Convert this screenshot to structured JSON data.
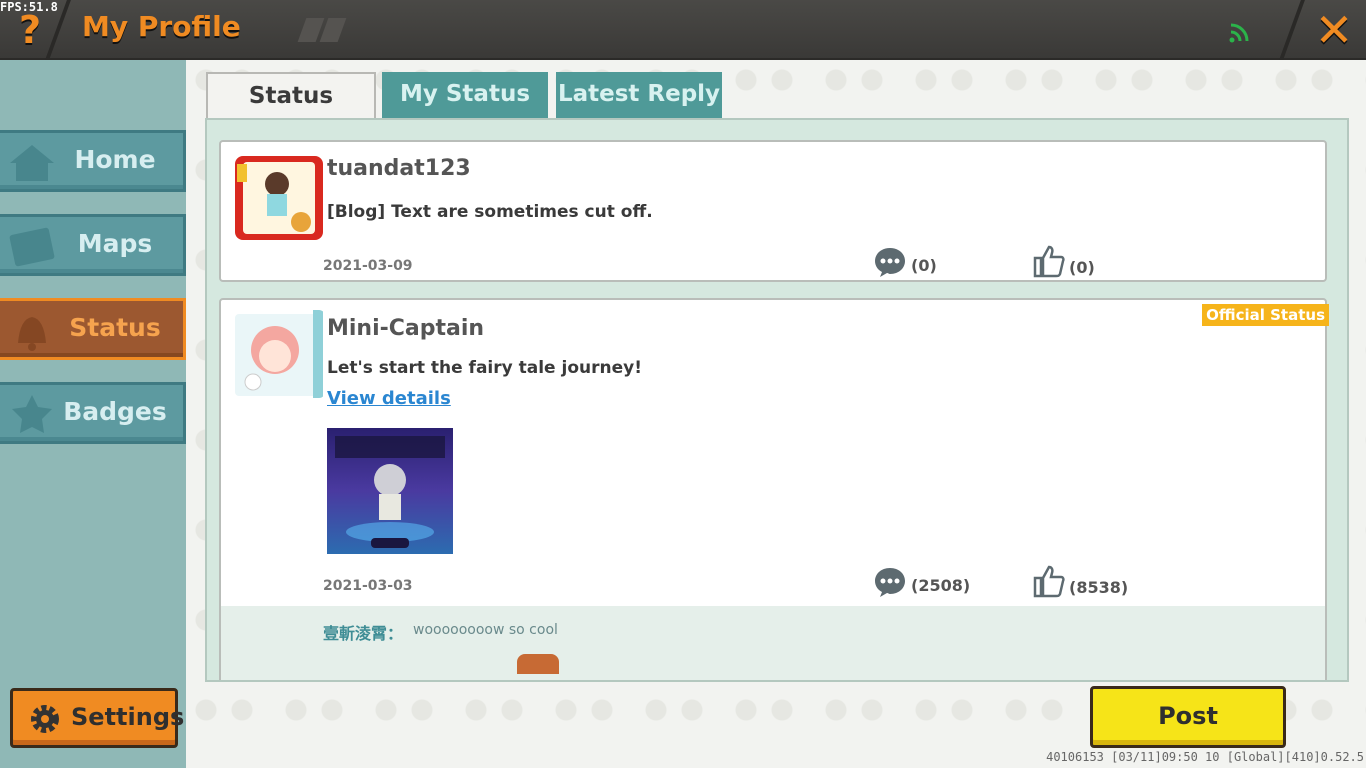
{
  "header": {
    "fps": "FPS:51.8",
    "help_symbol": "?",
    "title": "My Profile",
    "close_symbol": "✕"
  },
  "sidebar": {
    "items": [
      {
        "label": "Home",
        "icon": "home-icon",
        "active": false
      },
      {
        "label": "Maps",
        "icon": "map-icon",
        "active": false
      },
      {
        "label": "Status",
        "icon": "bell-icon",
        "active": true
      },
      {
        "label": "Badges",
        "icon": "badge-icon",
        "active": false
      }
    ],
    "settings_label": "Settings"
  },
  "tabs": [
    {
      "label": "Status",
      "selected": true
    },
    {
      "label": "My Status",
      "selected": false
    },
    {
      "label": "Latest Reply",
      "selected": false
    }
  ],
  "posts": [
    {
      "username": "tuandat123",
      "text": "[Blog] Text are sometimes cut off.",
      "date": "2021-03-09",
      "comments": "(0)",
      "likes": "(0)"
    },
    {
      "username": "Mini-Captain",
      "badge": "Official Status",
      "text": "Let's start the fairy tale journey!",
      "link": "View details",
      "date": "2021-03-03",
      "comments": "(2508)",
      "likes": "(8538)",
      "reply": {
        "name": "壹斬淩霄：",
        "text": "woooooooow so cool"
      }
    }
  ],
  "post_button_label": "Post",
  "footer_info": "40106153   [03/11]09:50 10  [Global][410]0.52.5",
  "colors": {
    "accent_orange": "#f08b22",
    "sidebar_teal": "#5d9aa0",
    "tab_teal": "#4f9a98",
    "post_yellow": "#f6e418",
    "official_badge": "#f6b41a",
    "link_blue": "#2a86d1"
  }
}
